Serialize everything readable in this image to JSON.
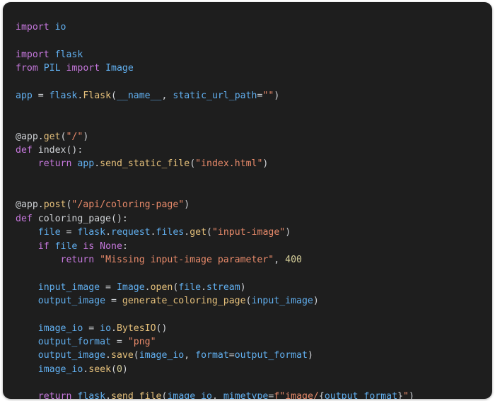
{
  "window": {
    "background_color": "#ffffff",
    "card_background": "#1e1e1e",
    "card_radius_px": 11
  },
  "theme": {
    "name": "dark-one-dark",
    "keyword_color": "#c678dd",
    "module_color": "#61afef",
    "variable_color": "#61afef",
    "function_color": "#e5c07b",
    "string_color": "#e88a6a",
    "number_color": "#d6cf9a",
    "plain_color": "#cfd2d6",
    "background_color": "#1e1e1e"
  },
  "code": {
    "language": "python",
    "filename_hint": "flask coloring-page app",
    "lines": [
      "import io",
      "",
      "import flask",
      "from PIL import Image",
      "",
      "app = flask.Flask(__name__, static_url_path=\"\")",
      "",
      "",
      "@app.get(\"/\")",
      "def index():",
      "    return app.send_static_file(\"index.html\")",
      "",
      "",
      "@app.post(\"/api/coloring-page\")",
      "def coloring_page():",
      "    file = flask.request.files.get(\"input-image\")",
      "    if file is None:",
      "        return \"Missing input-image parameter\", 400",
      "",
      "    input_image = Image.open(file.stream)",
      "    output_image = generate_coloring_page(input_image)",
      "",
      "    image_io = io.BytesIO()",
      "    output_format = \"png\"",
      "    output_image.save(image_io, format=output_format)",
      "    image_io.seek(0)",
      "",
      "    return flask.send_file(image_io, mimetype=f\"image/{output_format}\")"
    ],
    "tokens": [
      [
        [
          "import",
          "kw"
        ],
        [
          " ",
          "op"
        ],
        [
          "io",
          "mod"
        ]
      ],
      [],
      [
        [
          "import",
          "kw"
        ],
        [
          " ",
          "op"
        ],
        [
          "flask",
          "mod"
        ]
      ],
      [
        [
          "from",
          "kw"
        ],
        [
          " ",
          "op"
        ],
        [
          "PIL",
          "mod"
        ],
        [
          " ",
          "op"
        ],
        [
          "import",
          "kw"
        ],
        [
          " ",
          "op"
        ],
        [
          "Image",
          "mod"
        ]
      ],
      [],
      [
        [
          "app",
          "var"
        ],
        [
          " = ",
          "op"
        ],
        [
          "flask",
          "mod"
        ],
        [
          ".",
          "op"
        ],
        [
          "Flask",
          "fn"
        ],
        [
          "(",
          "op"
        ],
        [
          "__name__",
          "var"
        ],
        [
          ", ",
          "op"
        ],
        [
          "static_url_path",
          "var"
        ],
        [
          "=",
          "op"
        ],
        [
          "\"\"",
          "str"
        ],
        [
          ")",
          "op"
        ]
      ],
      [],
      [],
      [
        [
          "@app.",
          "plain"
        ],
        [
          "get",
          "fn"
        ],
        [
          "(",
          "op"
        ],
        [
          "\"/\"",
          "str"
        ],
        [
          ")",
          "op"
        ]
      ],
      [
        [
          "def",
          "kw"
        ],
        [
          " ",
          "op"
        ],
        [
          "index",
          "plain"
        ],
        [
          "():",
          "op"
        ]
      ],
      [
        [
          "    ",
          "op"
        ],
        [
          "return",
          "kw"
        ],
        [
          " ",
          "op"
        ],
        [
          "app",
          "mod"
        ],
        [
          ".",
          "op"
        ],
        [
          "send_static_file",
          "fn"
        ],
        [
          "(",
          "op"
        ],
        [
          "\"index.html\"",
          "str"
        ],
        [
          ")",
          "op"
        ]
      ],
      [],
      [],
      [
        [
          "@app.",
          "plain"
        ],
        [
          "post",
          "fn"
        ],
        [
          "(",
          "op"
        ],
        [
          "\"/api/coloring-page\"",
          "str"
        ],
        [
          ")",
          "op"
        ]
      ],
      [
        [
          "def",
          "kw"
        ],
        [
          " ",
          "op"
        ],
        [
          "coloring_page",
          "plain"
        ],
        [
          "():",
          "op"
        ]
      ],
      [
        [
          "    ",
          "op"
        ],
        [
          "file",
          "var"
        ],
        [
          " = ",
          "op"
        ],
        [
          "flask",
          "mod"
        ],
        [
          ".",
          "op"
        ],
        [
          "request",
          "mod"
        ],
        [
          ".",
          "op"
        ],
        [
          "files",
          "mod"
        ],
        [
          ".",
          "op"
        ],
        [
          "get",
          "fn"
        ],
        [
          "(",
          "op"
        ],
        [
          "\"input-image\"",
          "str"
        ],
        [
          ")",
          "op"
        ]
      ],
      [
        [
          "    ",
          "op"
        ],
        [
          "if",
          "kw"
        ],
        [
          " ",
          "op"
        ],
        [
          "file",
          "var"
        ],
        [
          " ",
          "op"
        ],
        [
          "is",
          "kw"
        ],
        [
          " ",
          "op"
        ],
        [
          "None",
          "kw"
        ],
        [
          ":",
          "op"
        ]
      ],
      [
        [
          "        ",
          "op"
        ],
        [
          "return",
          "kw"
        ],
        [
          " ",
          "op"
        ],
        [
          "\"Missing input-image parameter\"",
          "str"
        ],
        [
          ", ",
          "op"
        ],
        [
          "400",
          "num"
        ]
      ],
      [],
      [
        [
          "    ",
          "op"
        ],
        [
          "input_image",
          "var"
        ],
        [
          " = ",
          "op"
        ],
        [
          "Image",
          "mod"
        ],
        [
          ".",
          "op"
        ],
        [
          "open",
          "fn"
        ],
        [
          "(",
          "op"
        ],
        [
          "file",
          "var"
        ],
        [
          ".",
          "op"
        ],
        [
          "stream",
          "var"
        ],
        [
          ")",
          "op"
        ]
      ],
      [
        [
          "    ",
          "op"
        ],
        [
          "output_image",
          "var"
        ],
        [
          " = ",
          "op"
        ],
        [
          "generate_coloring_page",
          "fn"
        ],
        [
          "(",
          "op"
        ],
        [
          "input_image",
          "var"
        ],
        [
          ")",
          "op"
        ]
      ],
      [],
      [
        [
          "    ",
          "op"
        ],
        [
          "image_io",
          "var"
        ],
        [
          " = ",
          "op"
        ],
        [
          "io",
          "mod"
        ],
        [
          ".",
          "op"
        ],
        [
          "BytesIO",
          "fn"
        ],
        [
          "()",
          "op"
        ]
      ],
      [
        [
          "    ",
          "op"
        ],
        [
          "output_format",
          "var"
        ],
        [
          " = ",
          "op"
        ],
        [
          "\"png\"",
          "str"
        ]
      ],
      [
        [
          "    ",
          "op"
        ],
        [
          "output_image",
          "var"
        ],
        [
          ".",
          "op"
        ],
        [
          "save",
          "fn"
        ],
        [
          "(",
          "op"
        ],
        [
          "image_io",
          "var"
        ],
        [
          ", ",
          "op"
        ],
        [
          "format",
          "var"
        ],
        [
          "=",
          "op"
        ],
        [
          "output_format",
          "var"
        ],
        [
          ")",
          "op"
        ]
      ],
      [
        [
          "    ",
          "op"
        ],
        [
          "image_io",
          "var"
        ],
        [
          ".",
          "op"
        ],
        [
          "seek",
          "fn"
        ],
        [
          "(",
          "op"
        ],
        [
          "0",
          "num"
        ],
        [
          ")",
          "op"
        ]
      ],
      [],
      [
        [
          "    ",
          "op"
        ],
        [
          "return",
          "kw"
        ],
        [
          " ",
          "op"
        ],
        [
          "flask",
          "mod"
        ],
        [
          ".",
          "op"
        ],
        [
          "send_file",
          "fn"
        ],
        [
          "(",
          "op"
        ],
        [
          "image_io",
          "var"
        ],
        [
          ", ",
          "op"
        ],
        [
          "mimetype",
          "var"
        ],
        [
          "=",
          "op"
        ],
        [
          "f",
          "str"
        ],
        [
          "\"image/",
          "str"
        ],
        [
          "{",
          "op"
        ],
        [
          "output_format",
          "var"
        ],
        [
          "}",
          "op"
        ],
        [
          "\"",
          "str"
        ],
        [
          ")",
          "op"
        ]
      ]
    ]
  }
}
